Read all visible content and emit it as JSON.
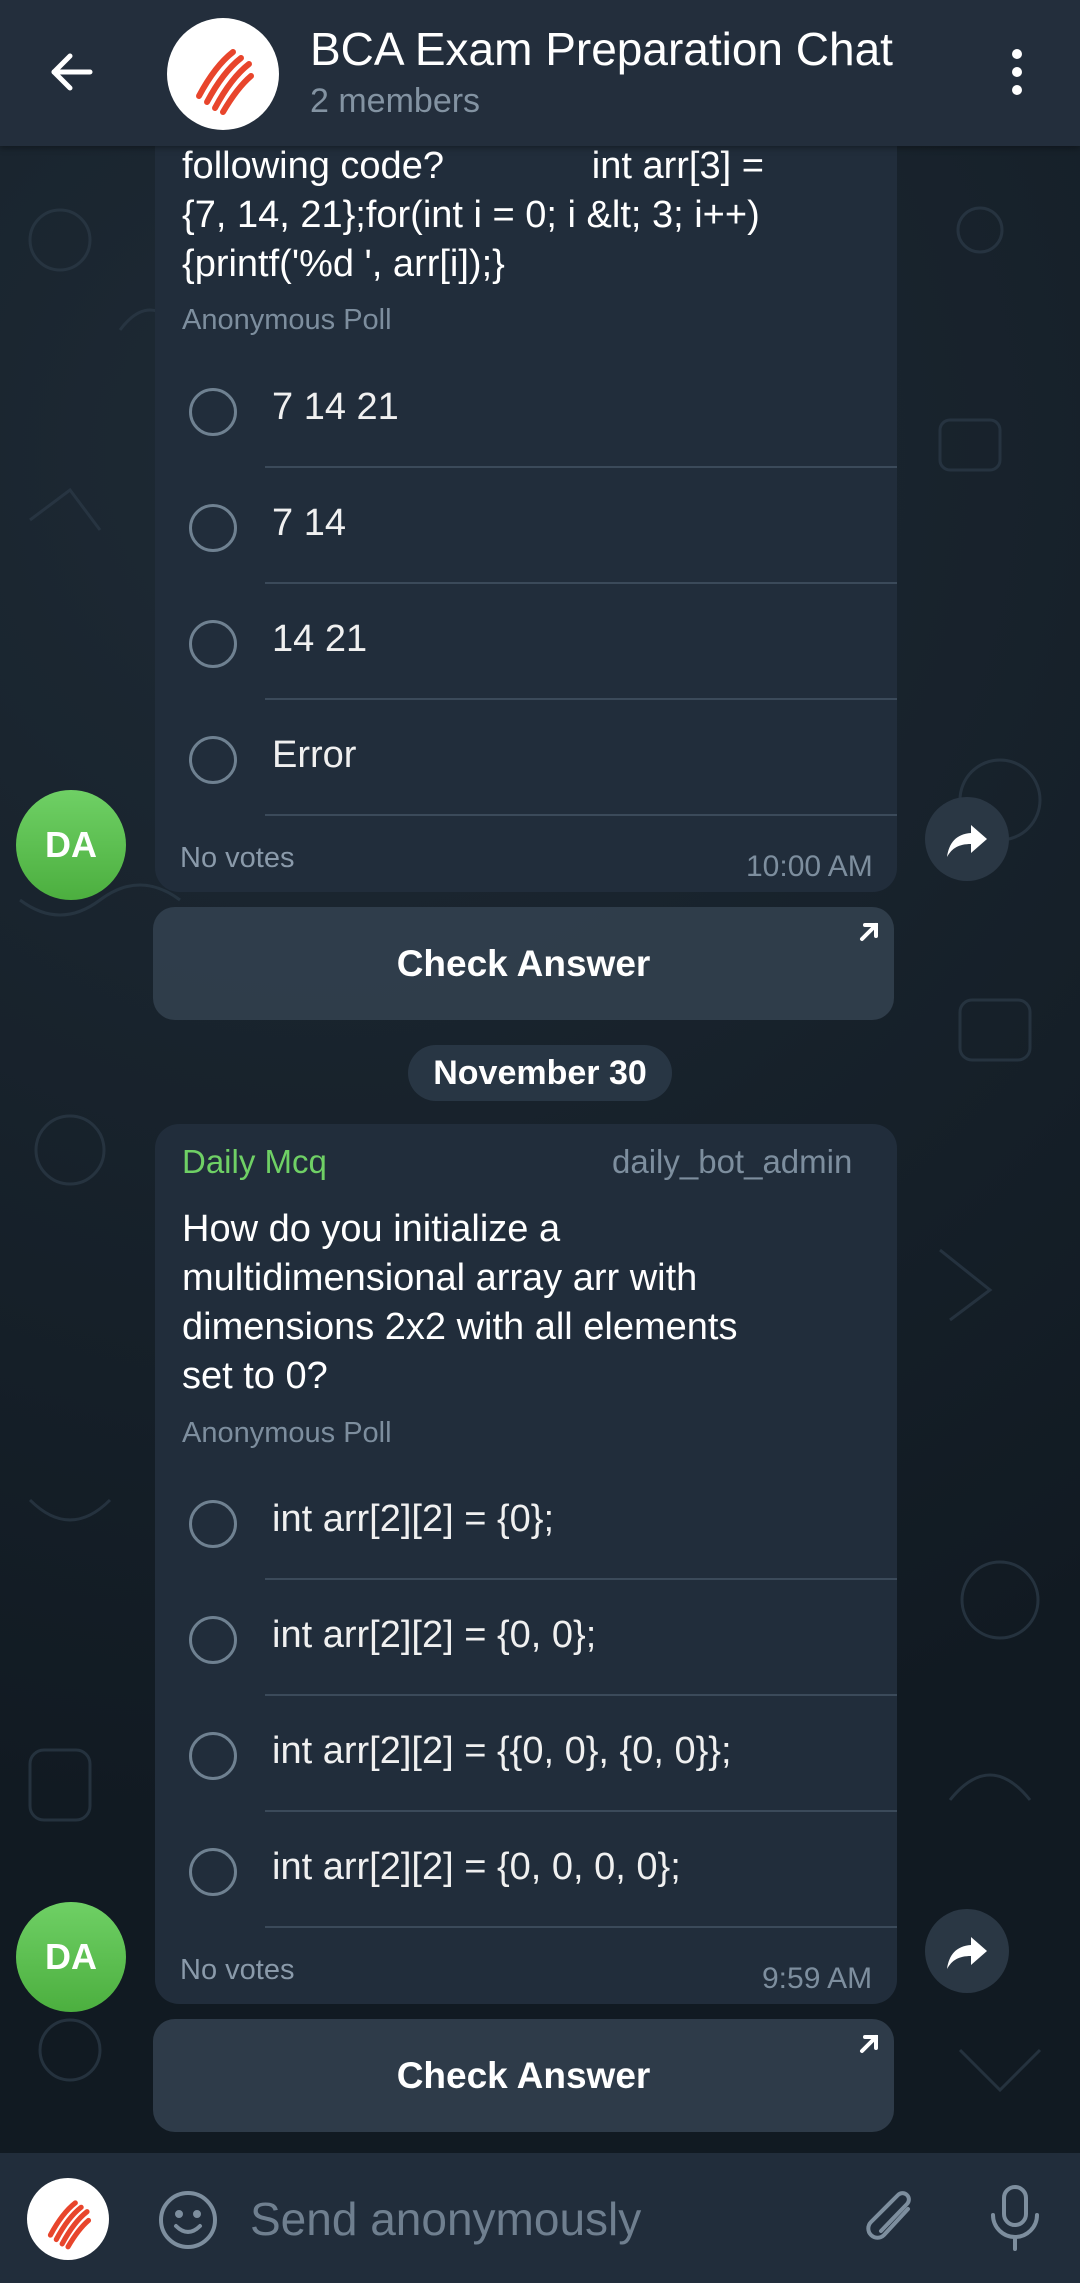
{
  "header": {
    "title": "BCA Exam Preparation Chat",
    "subtitle": "2 members"
  },
  "messages": [
    {
      "question": "following code?              int arr[3] = {7, 14, 21};for(int i = 0; i &lt; 3; i++){printf('%d ', arr[i]);}",
      "question_lines": [
        "following code?              int arr[3] =",
        "{7, 14, 21};for(int i = 0; i &lt; 3; i++)",
        "{printf('%d ', arr[i]);}"
      ],
      "poll_type": "Anonymous Poll",
      "options": [
        "7 14 21",
        "7 14",
        "14 21",
        "Error"
      ],
      "votes_text": "No votes",
      "time": "10:00 AM",
      "avatar_initials": "DA",
      "check_answer_label": "Check Answer"
    },
    {
      "sender_name": "Daily Mcq",
      "sender_username": "daily_bot_admin",
      "question_lines": [
        "How do you initialize a",
        "multidimensional array arr with",
        "dimensions 2x2 with all elements",
        "set to 0?"
      ],
      "poll_type": "Anonymous Poll",
      "options": [
        "int arr[2][2] = {0};",
        "int arr[2][2] = {0, 0};",
        "int arr[2][2] = {{0, 0}, {0, 0}};",
        "int arr[2][2] = {0, 0, 0, 0};"
      ],
      "votes_text": "No votes",
      "time": "9:59 AM",
      "avatar_initials": "DA",
      "check_answer_label": "Check Answer"
    }
  ],
  "date_separator": "November 30",
  "input": {
    "placeholder": "Send anonymously"
  },
  "colors": {
    "header_bg": "#232e3c",
    "bubble_bg": "#212d3b",
    "sender_green": "#6fd065",
    "avatar_green": "#4caf3f"
  },
  "icons": {
    "back": "arrow-left-icon",
    "menu": "more-vertical-icon",
    "share": "share-arrow-icon",
    "emoji": "smiley-icon",
    "attach": "paperclip-icon",
    "mic": "microphone-icon",
    "external": "external-link-arrow-icon"
  }
}
